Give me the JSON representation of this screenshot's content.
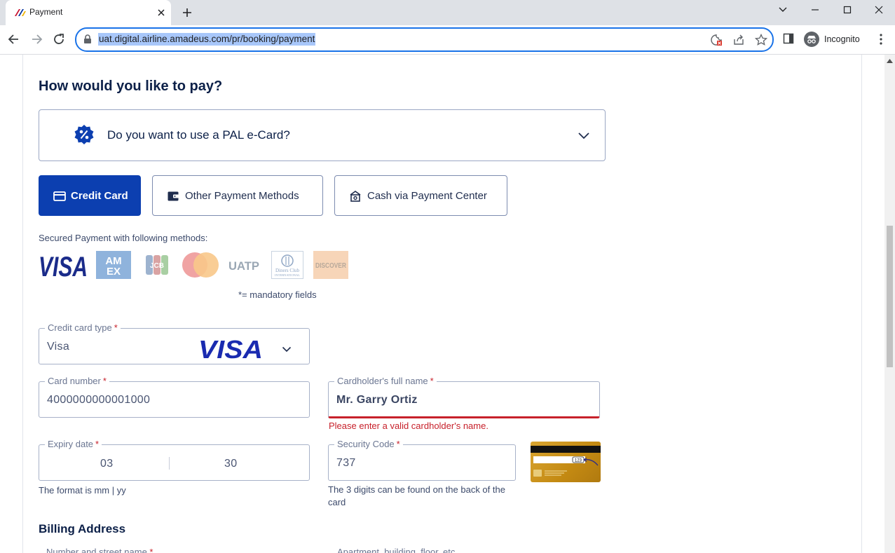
{
  "browser": {
    "tab_title": "Payment",
    "url": "uat.digital.airline.amadeus.com/pr/booking/payment",
    "profile_label": "Incognito"
  },
  "page": {
    "heading": "How would you like to pay?",
    "ecard_question": "Do you want to use a PAL e-Card?",
    "payment_methods": [
      {
        "label": "Credit Card",
        "icon": "credit-card-icon",
        "active": true
      },
      {
        "label": "Other Payment Methods",
        "icon": "wallet-icon",
        "active": false
      },
      {
        "label": "Cash via Payment Center",
        "icon": "cash-icon",
        "active": false
      }
    ],
    "secured_text": "Secured Payment with following methods:",
    "accepted_cards": [
      "VISA",
      "AMEX",
      "JCB",
      "Mastercard",
      "UATP",
      "Diners Club International",
      "DISCOVER"
    ],
    "mandatory_note": "*= mandatory fields",
    "card_type": {
      "label": "Credit card type",
      "required_mark": "*",
      "value": "Visa",
      "brand_logo": "VISA"
    },
    "card_number": {
      "label": "Card number",
      "required_mark": "*",
      "value": "4000000000001000"
    },
    "cardholder": {
      "label": "Cardholder's full name",
      "required_mark": "*",
      "value": "Mr. Garry Ortiz",
      "error": "Please enter a valid cardholder's name."
    },
    "expiry": {
      "label": "Expiry date",
      "required_mark": "*",
      "month": "03",
      "year": "30",
      "hint": "The format is mm | yy"
    },
    "security_code": {
      "label": "Security Code",
      "required_mark": "*",
      "value": "737",
      "hint": "The 3 digits can be found on the back of the card",
      "card_sample_code": "123"
    },
    "billing_heading": "Billing Address",
    "billing_street_label": "Number and street name",
    "billing_apartment_label": "Apartment, building, floor, etc."
  },
  "colors": {
    "primary": "#0c3fb0",
    "error": "#c7212b",
    "heading": "#0c2048",
    "omnibox_border": "#1a73e8"
  }
}
